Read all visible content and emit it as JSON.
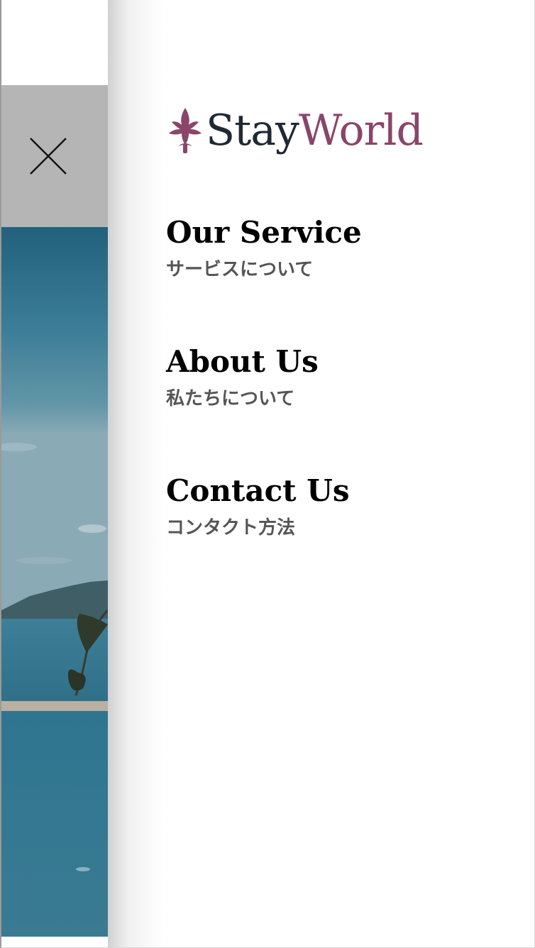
{
  "brand": {
    "name_part1": "Stay",
    "name_part2": "World",
    "logo_icon": "fleur-de-lis-icon",
    "colors": {
      "dark": "#1f2933",
      "accent": "#8a4569"
    }
  },
  "close_button": {
    "icon": "close-icon",
    "bar_color": "#b5b5b5"
  },
  "menu": {
    "items": [
      {
        "title": "Our Service",
        "subtitle": "サービスについて"
      },
      {
        "title": "About Us",
        "subtitle": "私たちについて"
      },
      {
        "title": "Contact Us",
        "subtitle": "コンタクト方法"
      }
    ]
  },
  "background": {
    "image": "seaside-resort-photo"
  }
}
